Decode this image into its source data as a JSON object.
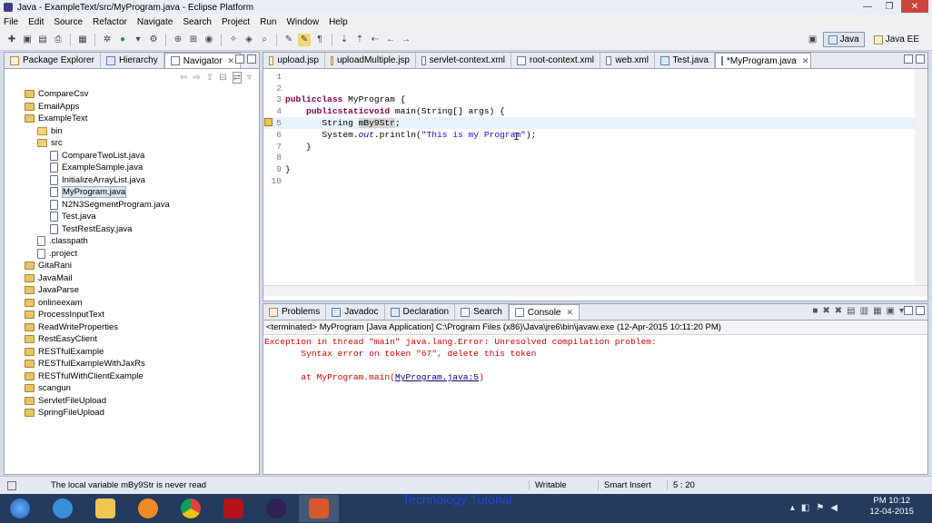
{
  "window": {
    "title": "Java - ExampleText/src/MyProgram.java - Eclipse Platform"
  },
  "menu": [
    "File",
    "Edit",
    "Source",
    "Refactor",
    "Navigate",
    "Search",
    "Project",
    "Run",
    "Window",
    "Help"
  ],
  "perspectives": [
    "Java",
    "Java EE"
  ],
  "left_tabs": [
    "Package Explorer",
    "Hierarchy",
    "Navigator"
  ],
  "tree": [
    {
      "label": "CompareCsv",
      "type": "proj",
      "indent": 0
    },
    {
      "label": "EmailApps",
      "type": "proj",
      "indent": 0
    },
    {
      "label": "ExampleText",
      "type": "proj",
      "indent": 0
    },
    {
      "label": "bin",
      "type": "folder",
      "indent": 1
    },
    {
      "label": "src",
      "type": "src",
      "indent": 1
    },
    {
      "label": "CompareTwoList.java",
      "type": "java",
      "indent": 2
    },
    {
      "label": "ExampleSample.java",
      "type": "java",
      "indent": 2
    },
    {
      "label": "InitializeArrayList.java",
      "type": "java",
      "indent": 2
    },
    {
      "label": "MyProgram.java",
      "type": "java",
      "indent": 2,
      "selected": true
    },
    {
      "label": "N2N3SegmentProgram.java",
      "type": "java",
      "indent": 2
    },
    {
      "label": "Test.java",
      "type": "java",
      "indent": 2
    },
    {
      "label": "TestRestEasy.java",
      "type": "java",
      "indent": 2
    },
    {
      "label": ".classpath",
      "type": "xfile",
      "indent": 1
    },
    {
      "label": ".project",
      "type": "xfile",
      "indent": 1
    },
    {
      "label": "GitaRani",
      "type": "proj",
      "indent": 0
    },
    {
      "label": "JavaMail",
      "type": "proj",
      "indent": 0
    },
    {
      "label": "JavaParse",
      "type": "proj",
      "indent": 0
    },
    {
      "label": "onlineexam",
      "type": "proj",
      "indent": 0
    },
    {
      "label": "ProcessInputText",
      "type": "proj",
      "indent": 0
    },
    {
      "label": "ReadWriteProperties",
      "type": "proj",
      "indent": 0
    },
    {
      "label": "RestEasyClient",
      "type": "proj",
      "indent": 0
    },
    {
      "label": "RESTfulExample",
      "type": "proj",
      "indent": 0
    },
    {
      "label": "RESTfulExampleWithJaxRs",
      "type": "proj",
      "indent": 0
    },
    {
      "label": "RESTfulWithClientExample",
      "type": "proj",
      "indent": 0
    },
    {
      "label": "scangun",
      "type": "proj",
      "indent": 0
    },
    {
      "label": "ServletFileUpload",
      "type": "proj",
      "indent": 0
    },
    {
      "label": "SpringFileUpload",
      "type": "proj",
      "indent": 0
    }
  ],
  "editor_tabs": [
    {
      "label": "upload.jsp",
      "type": "jsp"
    },
    {
      "label": "uploadMultiple.jsp",
      "type": "jsp"
    },
    {
      "label": "servlet-context.xml",
      "type": "file"
    },
    {
      "label": "root-context.xml",
      "type": "file"
    },
    {
      "label": "web.xml",
      "type": "file"
    },
    {
      "label": "Test.java",
      "type": "java"
    },
    {
      "label": "*MyProgram.java",
      "type": "java",
      "active": true
    }
  ],
  "code": {
    "line_numbers": [
      "1",
      "2",
      "3",
      "4",
      "5",
      "6",
      "7",
      "8",
      "9",
      "10"
    ],
    "l3_kw1": "public",
    "l3_kw2": "class",
    "l3_rest": " MyProgram {",
    "l4_kw1": "public",
    "l4_kw2": "static",
    "l4_kw3": "void",
    "l4_rest": " main(String[] args) {",
    "l5_type": "String ",
    "l5_var": "mBy9Str",
    "l5_end": ";",
    "l6_a": "System.",
    "l6_out": "out",
    "l6_b": ".println(",
    "l6_str": "\"This is my Program\"",
    "l6_c": ");",
    "l7": "}",
    "l9": "}"
  },
  "bottom_tabs": [
    "Problems",
    "Javadoc",
    "Declaration",
    "Search",
    "Console"
  ],
  "console": {
    "header": "<terminated> MyProgram [Java Application] C:\\Program Files (x86)\\Java\\jre6\\bin\\javaw.exe (12-Apr-2015 10:11:20 PM)",
    "line1": "Exception in thread \"main\" java.lang.Error: Unresolved compilation problem:",
    "line2": "Syntax error on token \"67\", delete this token",
    "line3_pre": "at MyProgram.main(",
    "line3_link": "MyProgram.java:5",
    "line3_post": ")"
  },
  "status": {
    "message": "The local variable mBy9Str is never read",
    "writable": "Writable",
    "insert": "Smart Insert",
    "position": "5 : 20"
  },
  "overlay_text": "Technology Tutorial",
  "clock": {
    "time": "PM 10:12",
    "date": "12-04-2015"
  }
}
